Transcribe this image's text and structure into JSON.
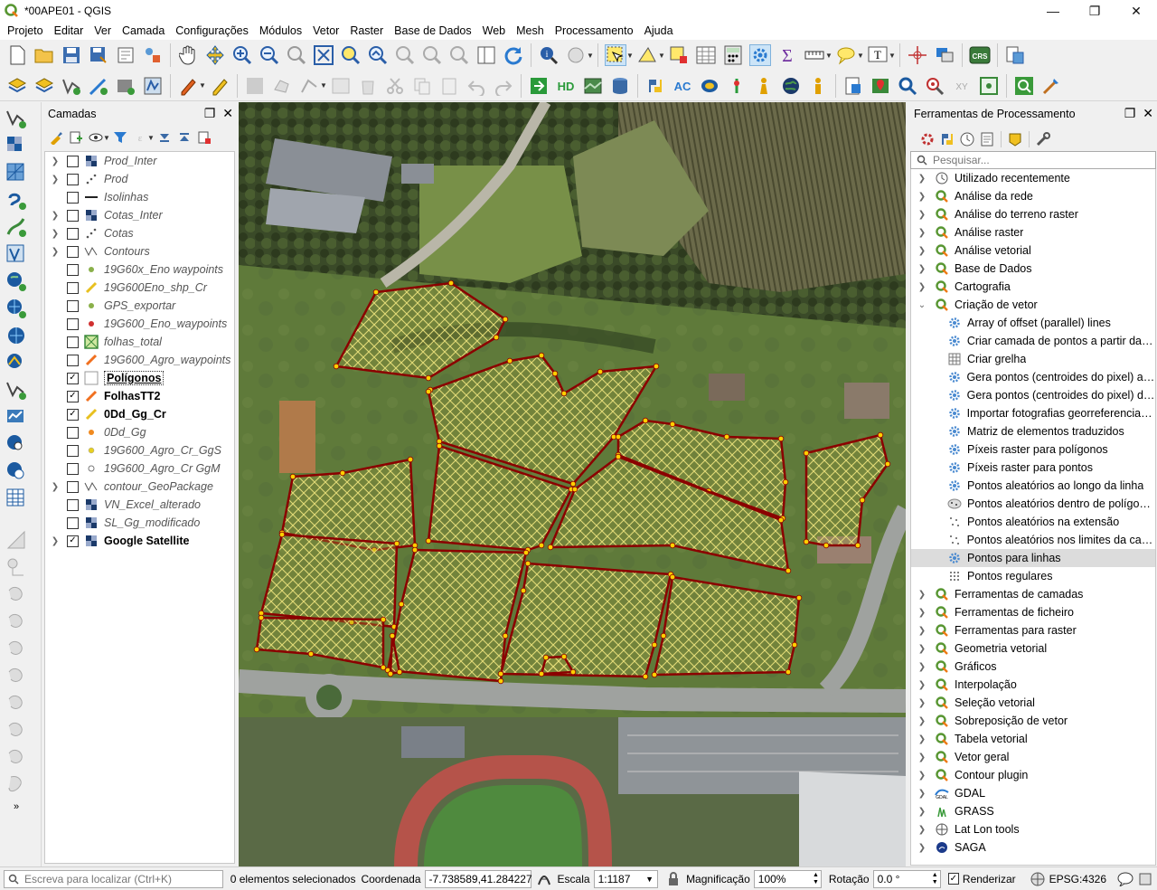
{
  "window": {
    "title": "*00APE01 - QGIS",
    "minimize": "—",
    "maximize": "❐",
    "close": "✕"
  },
  "menubar": [
    "Projeto",
    "Editar",
    "Ver",
    "Camada",
    "Configurações",
    "Módulos",
    "Vetor",
    "Raster",
    "Base de Dados",
    "Web",
    "Mesh",
    "Processamento",
    "Ajuda"
  ],
  "layers_panel": {
    "title": "Camadas",
    "float_icon": "❐",
    "close_icon": "✕",
    "layers": [
      {
        "name": "Prod_Inter",
        "checked": false,
        "expandable": true,
        "icon": "raster-icon"
      },
      {
        "name": "Prod",
        "checked": false,
        "expandable": true,
        "icon": "point-scatter-icon"
      },
      {
        "name": "Isolinhas",
        "checked": false,
        "expandable": false,
        "icon": "line-icon"
      },
      {
        "name": "Cotas_Inter",
        "checked": false,
        "expandable": true,
        "icon": "raster-icon"
      },
      {
        "name": "Cotas",
        "checked": false,
        "expandable": true,
        "icon": "point-scatter-icon"
      },
      {
        "name": "Contours",
        "checked": false,
        "expandable": true,
        "icon": "contour-icon"
      },
      {
        "name": "19G60x_Eno waypoints",
        "checked": false,
        "expandable": false,
        "icon": "point-green-icon"
      },
      {
        "name": "19G600Eno_shp_Cr",
        "checked": false,
        "expandable": false,
        "icon": "line-yellow-icon"
      },
      {
        "name": "GPS_exportar",
        "checked": false,
        "expandable": false,
        "icon": "point-green-icon"
      },
      {
        "name": "19G600_Eno_waypoints",
        "checked": false,
        "expandable": false,
        "icon": "point-red-icon"
      },
      {
        "name": "folhas_total",
        "checked": false,
        "expandable": false,
        "icon": "polygon-grid-icon"
      },
      {
        "name": "19G600_Agro_waypoints",
        "checked": false,
        "expandable": false,
        "icon": "line-orange-icon"
      },
      {
        "name": "Polígonos",
        "checked": true,
        "expandable": false,
        "icon": "polygon-empty-icon"
      },
      {
        "name": "FolhasTT2",
        "checked": true,
        "expandable": false,
        "icon": "line-orange-icon"
      },
      {
        "name": "0Dd_Gg_Cr",
        "checked": true,
        "expandable": false,
        "icon": "line-yellow-icon"
      },
      {
        "name": "0Dd_Gg",
        "checked": false,
        "expandable": false,
        "icon": "point-orange-icon"
      },
      {
        "name": "19G600_Agro_Cr_GgS",
        "checked": false,
        "expandable": false,
        "icon": "point-yellow-icon"
      },
      {
        "name": "19G600_Agro_Cr GgM",
        "checked": false,
        "expandable": false,
        "icon": "point-white-icon"
      },
      {
        "name": "contour_GeoPackage",
        "checked": false,
        "expandable": true,
        "icon": "contour-icon"
      },
      {
        "name": "VN_Excel_alterado",
        "checked": false,
        "expandable": false,
        "icon": "raster-icon"
      },
      {
        "name": "SL_Gg_modificado",
        "checked": false,
        "expandable": false,
        "icon": "raster-icon"
      },
      {
        "name": "Google Satellite",
        "checked": true,
        "expandable": true,
        "icon": "raster-icon"
      }
    ]
  },
  "processing_panel": {
    "title": "Ferramentas de Processamento",
    "float_icon": "❐",
    "close_icon": "✕",
    "search_placeholder": "Pesquisar...",
    "items": [
      {
        "label": "Utilizado recentemente",
        "level": 0,
        "expanded": false,
        "icon": "clock-icon"
      },
      {
        "label": "Análise da rede",
        "level": 0,
        "expanded": false,
        "icon": "qgis-icon"
      },
      {
        "label": "Análise do terreno raster",
        "level": 0,
        "expanded": false,
        "icon": "qgis-icon"
      },
      {
        "label": "Análise raster",
        "level": 0,
        "expanded": false,
        "icon": "qgis-icon"
      },
      {
        "label": "Análise vetorial",
        "level": 0,
        "expanded": false,
        "icon": "qgis-icon"
      },
      {
        "label": "Base de Dados",
        "level": 0,
        "expanded": false,
        "icon": "qgis-icon"
      },
      {
        "label": "Cartografia",
        "level": 0,
        "expanded": false,
        "icon": "qgis-icon"
      },
      {
        "label": "Criação de vetor",
        "level": 0,
        "expanded": true,
        "icon": "qgis-icon"
      },
      {
        "label": "Array of offset (parallel) lines",
        "level": 1,
        "icon": "gear-icon"
      },
      {
        "label": "Criar camada de pontos a partir da t...",
        "level": 1,
        "icon": "gear-icon"
      },
      {
        "label": "Criar grelha",
        "level": 1,
        "icon": "grid-icon"
      },
      {
        "label": "Gera pontos (centroides do pixel) ao ...",
        "level": 1,
        "icon": "gear-icon"
      },
      {
        "label": "Gera pontos (centroides do pixel) de...",
        "level": 1,
        "icon": "gear-icon"
      },
      {
        "label": "Importar fotografias georreferenciadas",
        "level": 1,
        "icon": "gear-icon"
      },
      {
        "label": "Matriz de elementos traduzidos",
        "level": 1,
        "icon": "gear-icon"
      },
      {
        "label": "Píxeis raster para polígonos",
        "level": 1,
        "icon": "gear-icon"
      },
      {
        "label": "Píxeis raster para pontos",
        "level": 1,
        "icon": "gear-icon"
      },
      {
        "label": "Pontos aleatórios ao longo da linha",
        "level": 1,
        "icon": "gear-icon"
      },
      {
        "label": "Pontos aleatórios dentro de polígonos",
        "level": 1,
        "icon": "points-polygon-icon"
      },
      {
        "label": "Pontos aleatórios na extensão",
        "level": 1,
        "icon": "points-extent-icon"
      },
      {
        "label": "Pontos aleatórios nos limites da cam...",
        "level": 1,
        "icon": "points-extent-icon"
      },
      {
        "label": "Pontos para linhas",
        "level": 1,
        "icon": "gear-icon",
        "selected": true
      },
      {
        "label": "Pontos regulares",
        "level": 1,
        "icon": "points-regular-icon"
      },
      {
        "label": "Ferramentas de camadas",
        "level": 0,
        "expanded": false,
        "icon": "qgis-icon"
      },
      {
        "label": "Ferramentas de ficheiro",
        "level": 0,
        "expanded": false,
        "icon": "qgis-icon"
      },
      {
        "label": "Ferramentas para raster",
        "level": 0,
        "expanded": false,
        "icon": "qgis-icon"
      },
      {
        "label": "Geometria vetorial",
        "level": 0,
        "expanded": false,
        "icon": "qgis-icon"
      },
      {
        "label": "Gráficos",
        "level": 0,
        "expanded": false,
        "icon": "qgis-icon"
      },
      {
        "label": "Interpolação",
        "level": 0,
        "expanded": false,
        "icon": "qgis-icon"
      },
      {
        "label": "Seleção vetorial",
        "level": 0,
        "expanded": false,
        "icon": "qgis-icon"
      },
      {
        "label": "Sobreposição de vetor",
        "level": 0,
        "expanded": false,
        "icon": "qgis-icon"
      },
      {
        "label": "Tabela vetorial",
        "level": 0,
        "expanded": false,
        "icon": "qgis-icon"
      },
      {
        "label": "Vetor geral",
        "level": 0,
        "expanded": false,
        "icon": "qgis-icon"
      },
      {
        "label": "Contour plugin",
        "level": 0,
        "expanded": false,
        "icon": "qgis-icon"
      },
      {
        "label": "GDAL",
        "level": 0,
        "expanded": false,
        "icon": "gdal-icon"
      },
      {
        "label": "GRASS",
        "level": 0,
        "expanded": false,
        "icon": "grass-icon"
      },
      {
        "label": "Lat Lon tools",
        "level": 0,
        "expanded": false,
        "icon": "latlon-icon"
      },
      {
        "label": "SAGA",
        "level": 0,
        "expanded": false,
        "icon": "saga-icon"
      }
    ]
  },
  "statusbar": {
    "locator_placeholder": "Escreva para localizar (Ctrl+K)",
    "selected": "0 elementos selecionados",
    "coord_label": "Coordenada",
    "coord_value": "-7.738589,41.284227",
    "scale_label": "Escala",
    "scale_value": "1:1187",
    "mag_label": "Magnificação",
    "mag_value": "100%",
    "rot_label": "Rotação",
    "rot_value": "0.0 °",
    "render_label": "Renderizar",
    "crs": "EPSG:4326"
  },
  "colors": {
    "polygon_outline": "#8b0000",
    "vertex": "#ffd000",
    "hatch": "#e8e07a"
  }
}
